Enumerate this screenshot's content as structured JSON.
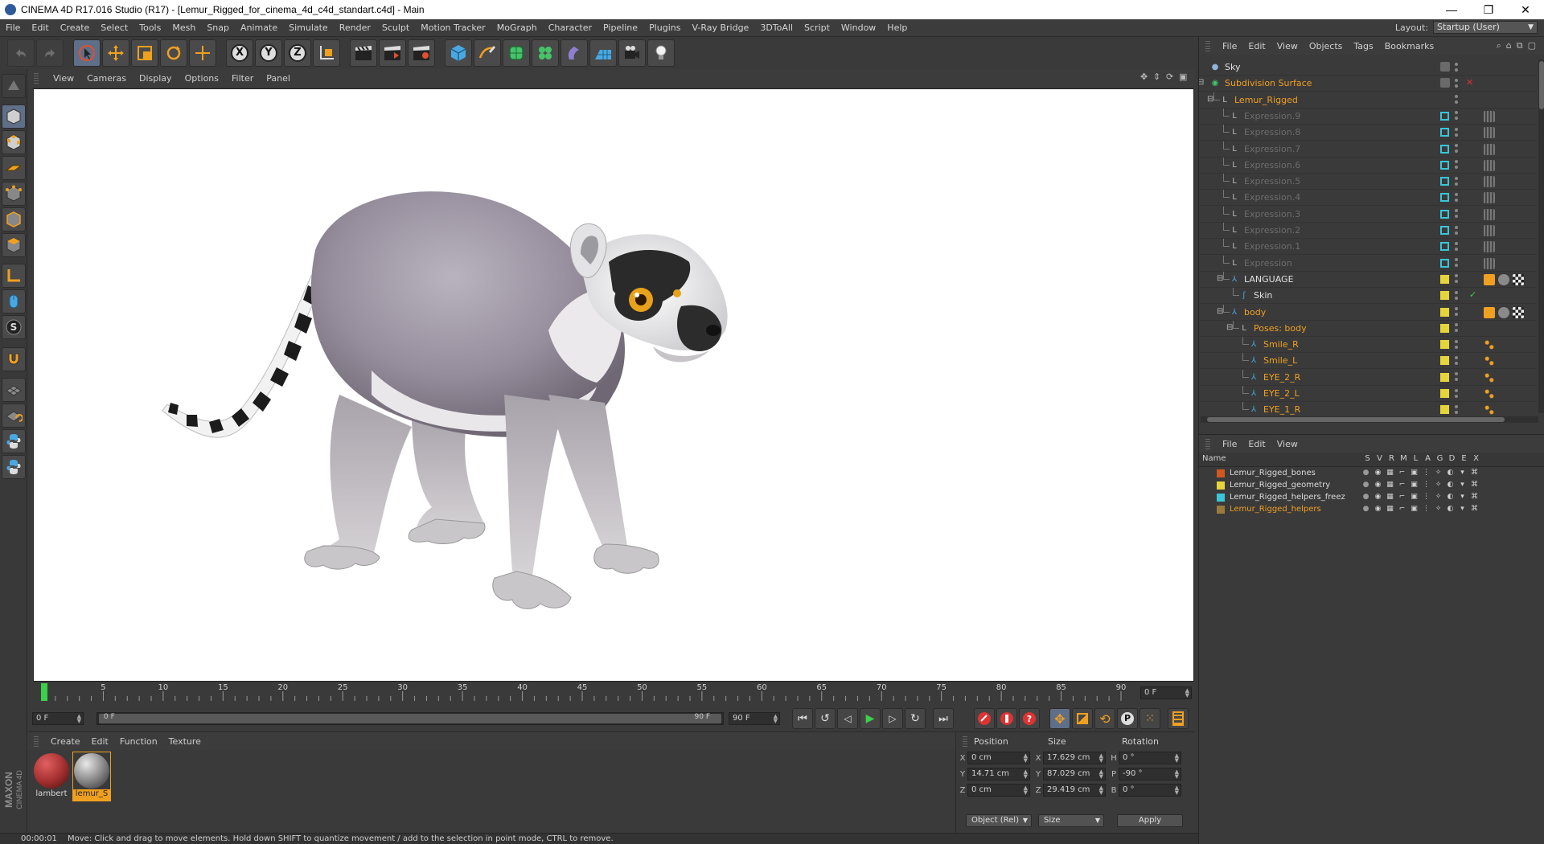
{
  "window": {
    "title": "CINEMA 4D R17.016 Studio (R17) - [Lemur_Rigged_for_cinema_4d_c4d_standart.c4d] - Main"
  },
  "menu": [
    "File",
    "Edit",
    "Create",
    "Select",
    "Tools",
    "Mesh",
    "Snap",
    "Animate",
    "Simulate",
    "Render",
    "Sculpt",
    "Motion Tracker",
    "MoGraph",
    "Character",
    "Pipeline",
    "Plugins",
    "V-Ray Bridge",
    "3DToAll",
    "Script",
    "Window",
    "Help"
  ],
  "layout": {
    "label": "Layout:",
    "value": "Startup (User)"
  },
  "toolbar": {
    "axis_x": "X",
    "axis_y": "Y",
    "axis_z": "Z"
  },
  "viewport": {
    "menu": [
      "View",
      "Cameras",
      "Display",
      "Options",
      "Filter",
      "Panel"
    ]
  },
  "timeline": {
    "ticks": [
      "0",
      "5",
      "10",
      "15",
      "20",
      "25",
      "30",
      "35",
      "40",
      "45",
      "50",
      "55",
      "60",
      "65",
      "70",
      "75",
      "80",
      "85",
      "90"
    ],
    "current_frame": "0 F"
  },
  "playbar": {
    "start_field": "0 F",
    "range_start": "0 F",
    "range_end": "90 F",
    "end_field": "90 F"
  },
  "materials": {
    "menu": [
      "Create",
      "Edit",
      "Function",
      "Texture"
    ],
    "items": [
      {
        "name": "lambert",
        "color": "#a83232"
      },
      {
        "name": "lemur_S",
        "color": "#8a8a8a"
      }
    ]
  },
  "coords": {
    "headers": [
      "Position",
      "Size",
      "Rotation"
    ],
    "rows": [
      {
        "axis": "X",
        "pos": "0 cm",
        "size_axis": "X",
        "size": "17.629 cm",
        "rot_axis": "H",
        "rot": "0 °"
      },
      {
        "axis": "Y",
        "pos": "14.71 cm",
        "size_axis": "Y",
        "size": "87.029 cm",
        "rot_axis": "P",
        "rot": "-90 °"
      },
      {
        "axis": "Z",
        "pos": "0 cm",
        "size_axis": "Z",
        "size": "29.419 cm",
        "rot_axis": "B",
        "rot": "0 °"
      }
    ],
    "mode_select": "Object (Rel)",
    "size_select": "Size",
    "apply": "Apply"
  },
  "status": {
    "time": "00:00:01",
    "message": "Move: Click and drag to move elements. Hold down SHIFT to quantize movement / add to the selection in point mode, CTRL to remove."
  },
  "branding": {
    "maxon": "MAXON",
    "product": "CINEMA 4D"
  },
  "object_manager": {
    "menu": [
      "File",
      "Edit",
      "View",
      "Objects",
      "Tags",
      "Bookmarks"
    ],
    "objects": [
      {
        "name": "Sky",
        "style": "normal",
        "indent": 0,
        "icon": "sky-icon"
      },
      {
        "name": "Subdivision Surface",
        "style": "orange",
        "indent": 0,
        "icon": "subdivision-icon"
      },
      {
        "name": "Lemur_Rigged",
        "style": "orange",
        "indent": 1,
        "icon": "null-icon"
      },
      {
        "name": "Expression.9",
        "style": "dim",
        "indent": 2,
        "icon": "null-icon"
      },
      {
        "name": "Expression.8",
        "style": "dim",
        "indent": 2,
        "icon": "null-icon"
      },
      {
        "name": "Expression.7",
        "style": "dim",
        "indent": 2,
        "icon": "null-icon"
      },
      {
        "name": "Expression.6",
        "style": "dim",
        "indent": 2,
        "icon": "null-icon"
      },
      {
        "name": "Expression.5",
        "style": "dim",
        "indent": 2,
        "icon": "null-icon"
      },
      {
        "name": "Expression.4",
        "style": "dim",
        "indent": 2,
        "icon": "null-icon"
      },
      {
        "name": "Expression.3",
        "style": "dim",
        "indent": 2,
        "icon": "null-icon"
      },
      {
        "name": "Expression.2",
        "style": "dim",
        "indent": 2,
        "icon": "null-icon"
      },
      {
        "name": "Expression.1",
        "style": "dim",
        "indent": 2,
        "icon": "null-icon"
      },
      {
        "name": "Expression",
        "style": "dim",
        "indent": 2,
        "icon": "null-icon"
      },
      {
        "name": "LANGUAGE",
        "style": "normal",
        "indent": 2,
        "icon": "joint-icon"
      },
      {
        "name": "Skin",
        "style": "normal",
        "indent": 3,
        "icon": "skin-icon"
      },
      {
        "name": "body",
        "style": "orange",
        "indent": 2,
        "icon": "joint-icon"
      },
      {
        "name": "Poses: body",
        "style": "orange",
        "indent": 3,
        "icon": "null-icon"
      },
      {
        "name": "Smile_R",
        "style": "orange",
        "indent": 4,
        "icon": "joint-icon"
      },
      {
        "name": "Smile_L",
        "style": "orange",
        "indent": 4,
        "icon": "joint-icon"
      },
      {
        "name": "EYE_2_R",
        "style": "orange",
        "indent": 4,
        "icon": "joint-icon"
      },
      {
        "name": "EYE_2_L",
        "style": "orange",
        "indent": 4,
        "icon": "joint-icon"
      },
      {
        "name": "EYE_1_R",
        "style": "orange",
        "indent": 4,
        "icon": "joint-icon"
      }
    ]
  },
  "layer_manager": {
    "menu": [
      "File",
      "Edit",
      "View"
    ],
    "columns": [
      "Name",
      "S",
      "V",
      "R",
      "M",
      "L",
      "A",
      "G",
      "D",
      "E",
      "X"
    ],
    "layers": [
      {
        "name": "Lemur_Rigged_bones",
        "color": "#d2571e",
        "style": "normal"
      },
      {
        "name": "Lemur_Rigged_geometry",
        "color": "#e5d43a",
        "style": "normal"
      },
      {
        "name": "Lemur_Rigged_helpers_freez",
        "color": "#3ac6d9",
        "style": "normal"
      },
      {
        "name": "Lemur_Rigged_helpers",
        "color": "#9a7a3a",
        "style": "orange"
      }
    ]
  },
  "colors": {
    "ui_bg": "#3a3a3a",
    "highlight": "#f0a020",
    "viewport_bg": "#ffffff"
  }
}
